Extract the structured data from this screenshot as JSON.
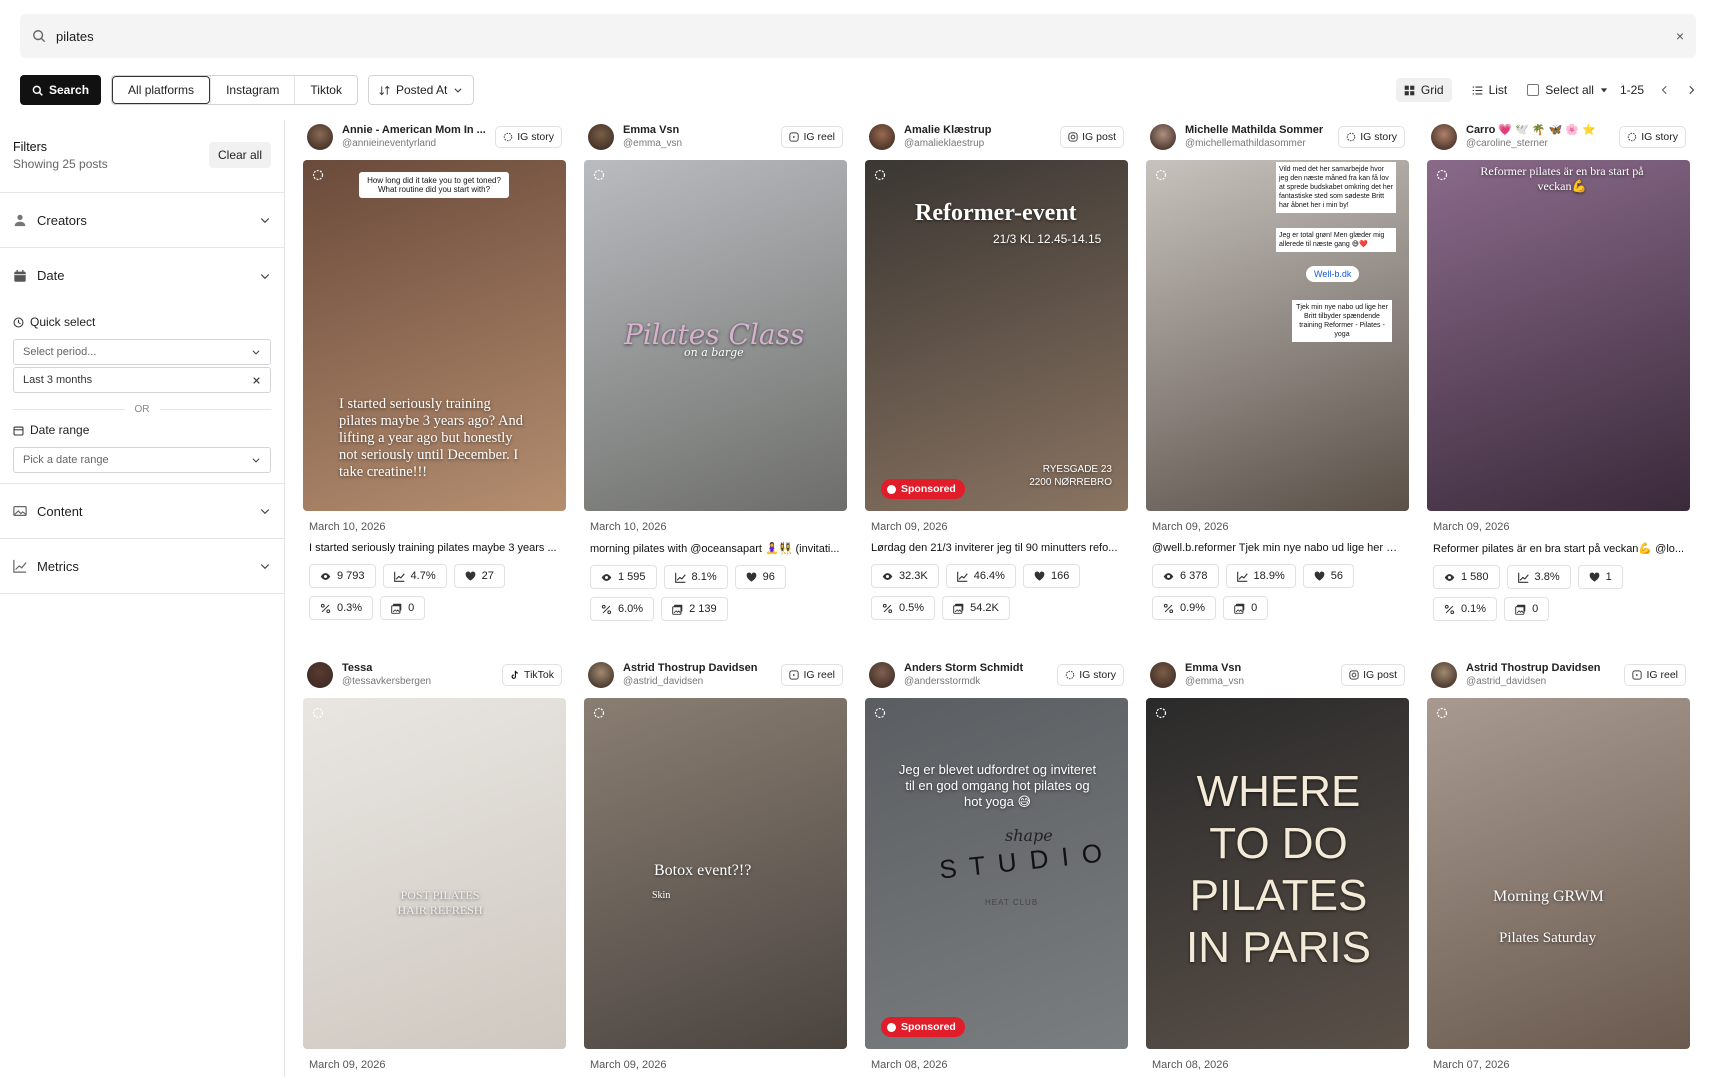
{
  "search": {
    "query": "pilates",
    "clear": "×"
  },
  "toolbar": {
    "search_label": "Search",
    "platforms": [
      "All platforms",
      "Instagram",
      "Tiktok"
    ],
    "sort_label": "Posted At",
    "grid_label": "Grid",
    "list_label": "List",
    "select_all_label": "Select all",
    "range": "1-25"
  },
  "sidebar": {
    "title": "Filters",
    "subtitle": "Showing 25 posts",
    "clear_all": "Clear all",
    "creators": "Creators",
    "date": "Date",
    "quick_select": "Quick select",
    "select_period_placeholder": "Select period...",
    "last_period": "Last 3 months",
    "or": "OR",
    "date_range": "Date range",
    "date_range_placeholder": "Pick a date range",
    "content": "Content",
    "metrics": "Metrics"
  },
  "posts": [
    {
      "name": "Annie - American Mom In ...",
      "handle": "@annieineventyrland",
      "type": "IG story",
      "platform": "story",
      "date": "March 10, 2026",
      "caption": "I started seriously training pilates maybe 3 years ...",
      "overlay": "I started seriously training pilates maybe 3 years ago? And lifting a year ago but honestly not seriously until December. I take creatine!!!",
      "question": "How long did it take you to get toned? What routine did you start with?",
      "views": "9 793",
      "er": "4.7%",
      "likes": "27",
      "pct": "0.3%",
      "saves": "0",
      "bg": [
        "#6a4a3a",
        "#b58e70"
      ],
      "avatar": "#8a6a55"
    },
    {
      "name": "Emma Vsn",
      "handle": "@emma_vsn",
      "type": "IG reel",
      "platform": "reel",
      "date": "March 10, 2026",
      "caption": "morning pilates with @oceansapart 🧘‍♀️👯‍♀️ (invitati...",
      "overlay": "Pilates Class",
      "overlay2": "on a barge",
      "views": "1 595",
      "er": "8.1%",
      "likes": "96",
      "pct": "6.0%",
      "saves": "2 139",
      "bg": [
        "#b9bcc0",
        "#6d6e6a"
      ],
      "avatar": "#7a5d48"
    },
    {
      "name": "Amalie Klæstrup",
      "handle": "@amalieklaestrup",
      "type": "IG post",
      "platform": "post",
      "date": "March 09, 2026",
      "caption": "Lørdag den 21/3 inviterer jeg til 90 minutters refo...",
      "overlay": "Reformer-event",
      "overlay2": "21/3 KL 12.45-14.15",
      "overlay3": "RYESGADE 23\n2200 NØRREBRO",
      "sponsored": "Sponsored",
      "views": "32.3K",
      "er": "46.4%",
      "likes": "166",
      "pct": "0.5%",
      "saves": "54.2K",
      "bg": [
        "#3a3632",
        "#8a7462"
      ],
      "avatar": "#9a6a50"
    },
    {
      "name": "Michelle Mathilda Sommer",
      "handle": "@michellemathildasommer",
      "type": "IG story",
      "platform": "story",
      "date": "March 09, 2026",
      "caption": "@well.b.reformer Tjek min nye nabo ud lige her Br...",
      "overlay": "Vild med det her samarbejde hvor jeg den næste måned fra kan få lov at sprede budskabet omkring det her fantastiske sted som sødeste Britt har åbnet her i min by!",
      "overlay2": "Jeg er total grøn! Men glæder mig allerede til næste gang 😅❤️",
      "link": "Well-b.dk",
      "overlay3": "Tjek min nye nabo ud lige her Britt tilbyder spændende training Reformer - Pilates - yoga",
      "views": "6 378",
      "er": "18.9%",
      "likes": "56",
      "pct": "0.9%",
      "saves": "0",
      "bg": [
        "#c7c2bd",
        "#5a5048"
      ],
      "avatar": "#b09080"
    },
    {
      "name": "Carro 💗 🕊️ 🌴 🦋 🌸 ⭐",
      "handle": "@caroline_sterner",
      "type": "IG story",
      "platform": "story",
      "date": "March 09, 2026",
      "caption": "Reformer pilates är en bra start på veckan💪 @lo...",
      "overlay": "Reformer pilates är en bra start på veckan💪",
      "views": "1 580",
      "er": "3.8%",
      "likes": "1",
      "pct": "0.1%",
      "saves": "0",
      "bg": [
        "#8a6a8a",
        "#3a2a3a"
      ],
      "avatar": "#b0806a"
    },
    {
      "name": "Tessa",
      "handle": "@tessavkersbergen",
      "type": "TikTok",
      "platform": "tiktok",
      "date": "March 09, 2026",
      "overlay": "POST PILATES HAIR REFRESH",
      "bg": [
        "#e9e6e2",
        "#cfc8c0"
      ],
      "avatar": "#5a3a30"
    },
    {
      "name": "Astrid Thostrup Davidsen",
      "handle": "@astrid_davidsen",
      "type": "IG reel",
      "platform": "reel",
      "date": "March 09, 2026",
      "overlay": "Botox event?!?",
      "overlay2": "Skin",
      "bg": [
        "#8a7e72",
        "#4a4440"
      ],
      "avatar": "#a08a70"
    },
    {
      "name": "Anders Storm Schmidt",
      "handle": "@andersstormdk",
      "type": "IG story",
      "platform": "story",
      "date": "March 08, 2026",
      "overlay": "Jeg er blevet udfordret og inviteret til en god omgang hot pilates og hot yoga 😅",
      "overlay2": "shape",
      "overlay3": "S T U D I O",
      "overlay4": "HEAT CLUB",
      "sponsored": "Sponsored",
      "bg": [
        "#5a5e62",
        "#7a7e80"
      ],
      "avatar": "#806050"
    },
    {
      "name": "Emma Vsn",
      "handle": "@emma_vsn",
      "type": "IG post",
      "platform": "post",
      "date": "March 08, 2026",
      "overlay": "WHERE TO DO PILATES IN PARIS",
      "bg": [
        "#2a2a2a",
        "#5a5048"
      ],
      "avatar": "#7a5d48"
    },
    {
      "name": "Astrid Thostrup Davidsen",
      "handle": "@astrid_davidsen",
      "type": "IG reel",
      "platform": "reel",
      "date": "March 07, 2026",
      "overlay": "Morning GRWM",
      "overlay2": "Pilates Saturday",
      "bg": [
        "#a89a90",
        "#6a5a50"
      ],
      "avatar": "#a08a70"
    }
  ]
}
